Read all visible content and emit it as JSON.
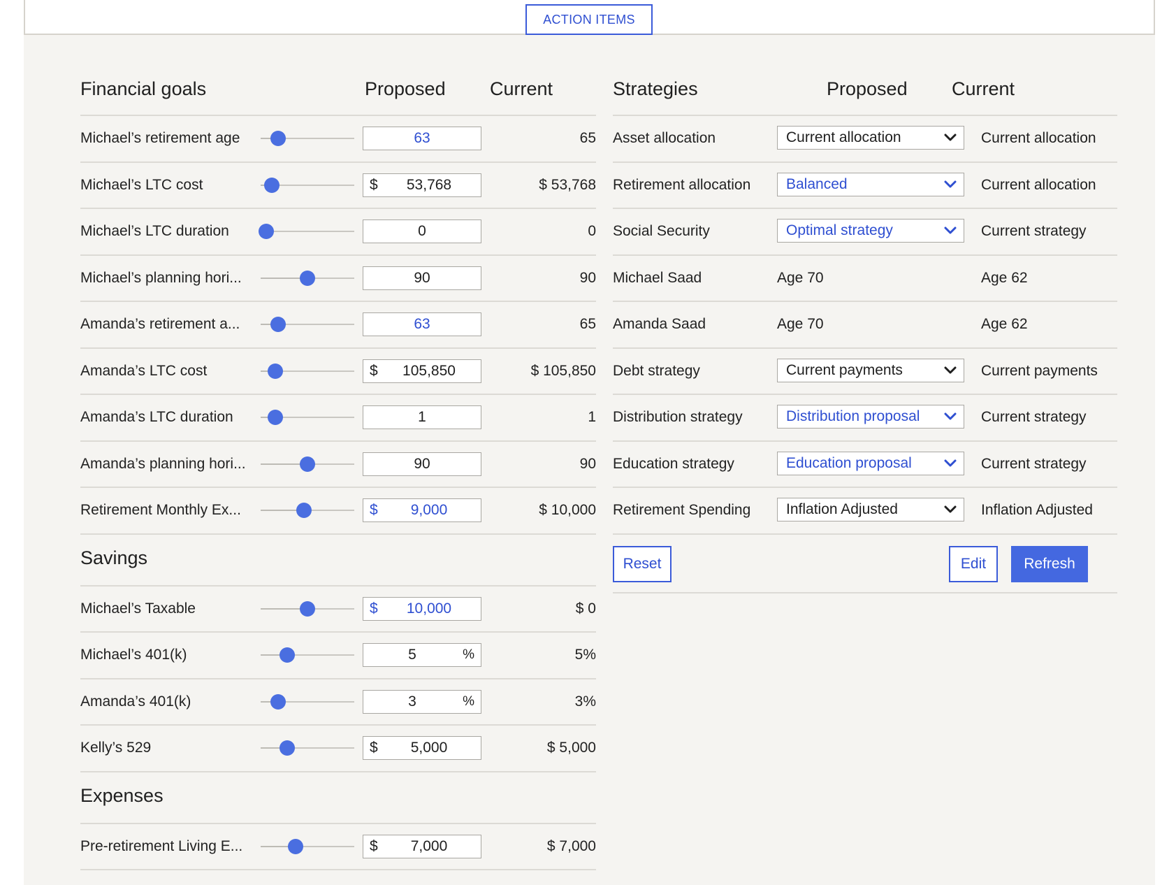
{
  "header": {
    "action_items": "ACTION ITEMS"
  },
  "goals": {
    "col_title": "Financial goals",
    "col_proposed": "Proposed",
    "col_current": "Current",
    "rows": [
      {
        "label": "Michael’s retirement age",
        "prefix": "",
        "value": "63",
        "suffix": "",
        "current": "65",
        "changed": true,
        "slider": 0.19
      },
      {
        "label": "Michael’s LTC cost",
        "prefix": "$",
        "value": "53,768",
        "suffix": "",
        "current": "$ 53,768",
        "changed": false,
        "slider": 0.12
      },
      {
        "label": "Michael’s LTC duration",
        "prefix": "",
        "value": "0",
        "suffix": "",
        "current": "0",
        "changed": false,
        "slider": 0.06
      },
      {
        "label": "Michael’s planning hori...",
        "prefix": "",
        "value": "90",
        "suffix": "",
        "current": "90",
        "changed": false,
        "slider": 0.5
      },
      {
        "label": "Amanda’s retirement a...",
        "prefix": "",
        "value": "63",
        "suffix": "",
        "current": "65",
        "changed": true,
        "slider": 0.19
      },
      {
        "label": "Amanda’s LTC cost",
        "prefix": "$",
        "value": "105,850",
        "suffix": "",
        "current": "$ 105,850",
        "changed": false,
        "slider": 0.16
      },
      {
        "label": "Amanda’s LTC duration",
        "prefix": "",
        "value": "1",
        "suffix": "",
        "current": "1",
        "changed": false,
        "slider": 0.16
      },
      {
        "label": "Amanda’s planning hori...",
        "prefix": "",
        "value": "90",
        "suffix": "",
        "current": "90",
        "changed": false,
        "slider": 0.5
      },
      {
        "label": "Retirement Monthly Ex...",
        "prefix": "$",
        "value": "9,000",
        "suffix": "",
        "current": "$ 10,000",
        "changed": true,
        "slider": 0.46
      }
    ]
  },
  "savings": {
    "title": "Savings",
    "rows": [
      {
        "label": "Michael’s Taxable",
        "prefix": "$",
        "value": "10,000",
        "suffix": "",
        "current": "$ 0",
        "changed": true,
        "slider": 0.5
      },
      {
        "label": "Michael’s 401(k)",
        "prefix": "",
        "value": "5",
        "suffix": "%",
        "current": "5%",
        "changed": false,
        "slider": 0.28
      },
      {
        "label": "Amanda’s 401(k)",
        "prefix": "",
        "value": "3",
        "suffix": "%",
        "current": "3%",
        "changed": false,
        "slider": 0.19
      },
      {
        "label": "Kelly’s 529",
        "prefix": "$",
        "value": "5,000",
        "suffix": "",
        "current": "$ 5,000",
        "changed": false,
        "slider": 0.28
      }
    ]
  },
  "expenses": {
    "title": "Expenses",
    "rows": [
      {
        "label": "Pre-retirement Living E...",
        "prefix": "$",
        "value": "7,000",
        "suffix": "",
        "current": "$ 7,000",
        "changed": false,
        "slider": 0.37
      }
    ]
  },
  "strategies": {
    "col_title": "Strategies",
    "col_proposed": "Proposed",
    "col_current": "Current",
    "rows": [
      {
        "label": "Asset allocation",
        "type": "select",
        "value": "Current allocation",
        "current": "Current allocation",
        "changed": false
      },
      {
        "label": "Retirement allocation",
        "type": "select",
        "value": "Balanced",
        "current": "Current allocation",
        "changed": true
      },
      {
        "label": "Social Security",
        "type": "select",
        "value": "Optimal strategy",
        "current": "Current strategy",
        "changed": true
      },
      {
        "label": "Michael Saad",
        "type": "text",
        "value": "Age 70",
        "current": "Age 62",
        "changed": false
      },
      {
        "label": "Amanda Saad",
        "type": "text",
        "value": "Age 70",
        "current": "Age 62",
        "changed": false
      },
      {
        "label": "Debt strategy",
        "type": "select",
        "value": "Current payments",
        "current": "Current payments",
        "changed": false
      },
      {
        "label": "Distribution strategy",
        "type": "select",
        "value": "Distribution proposal",
        "current": "Current strategy",
        "changed": true
      },
      {
        "label": "Education strategy",
        "type": "select",
        "value": "Education proposal",
        "current": "Current strategy",
        "changed": true
      },
      {
        "label": "Retirement Spending",
        "type": "select",
        "value": "Inflation Adjusted",
        "current": "Inflation Adjusted",
        "changed": false
      }
    ],
    "buttons": {
      "reset": "Reset",
      "edit": "Edit",
      "refresh": "Refresh"
    }
  },
  "colors": {
    "accent": "#4468e0",
    "link": "#2f4fd1",
    "panel": "#f5f4f1"
  }
}
